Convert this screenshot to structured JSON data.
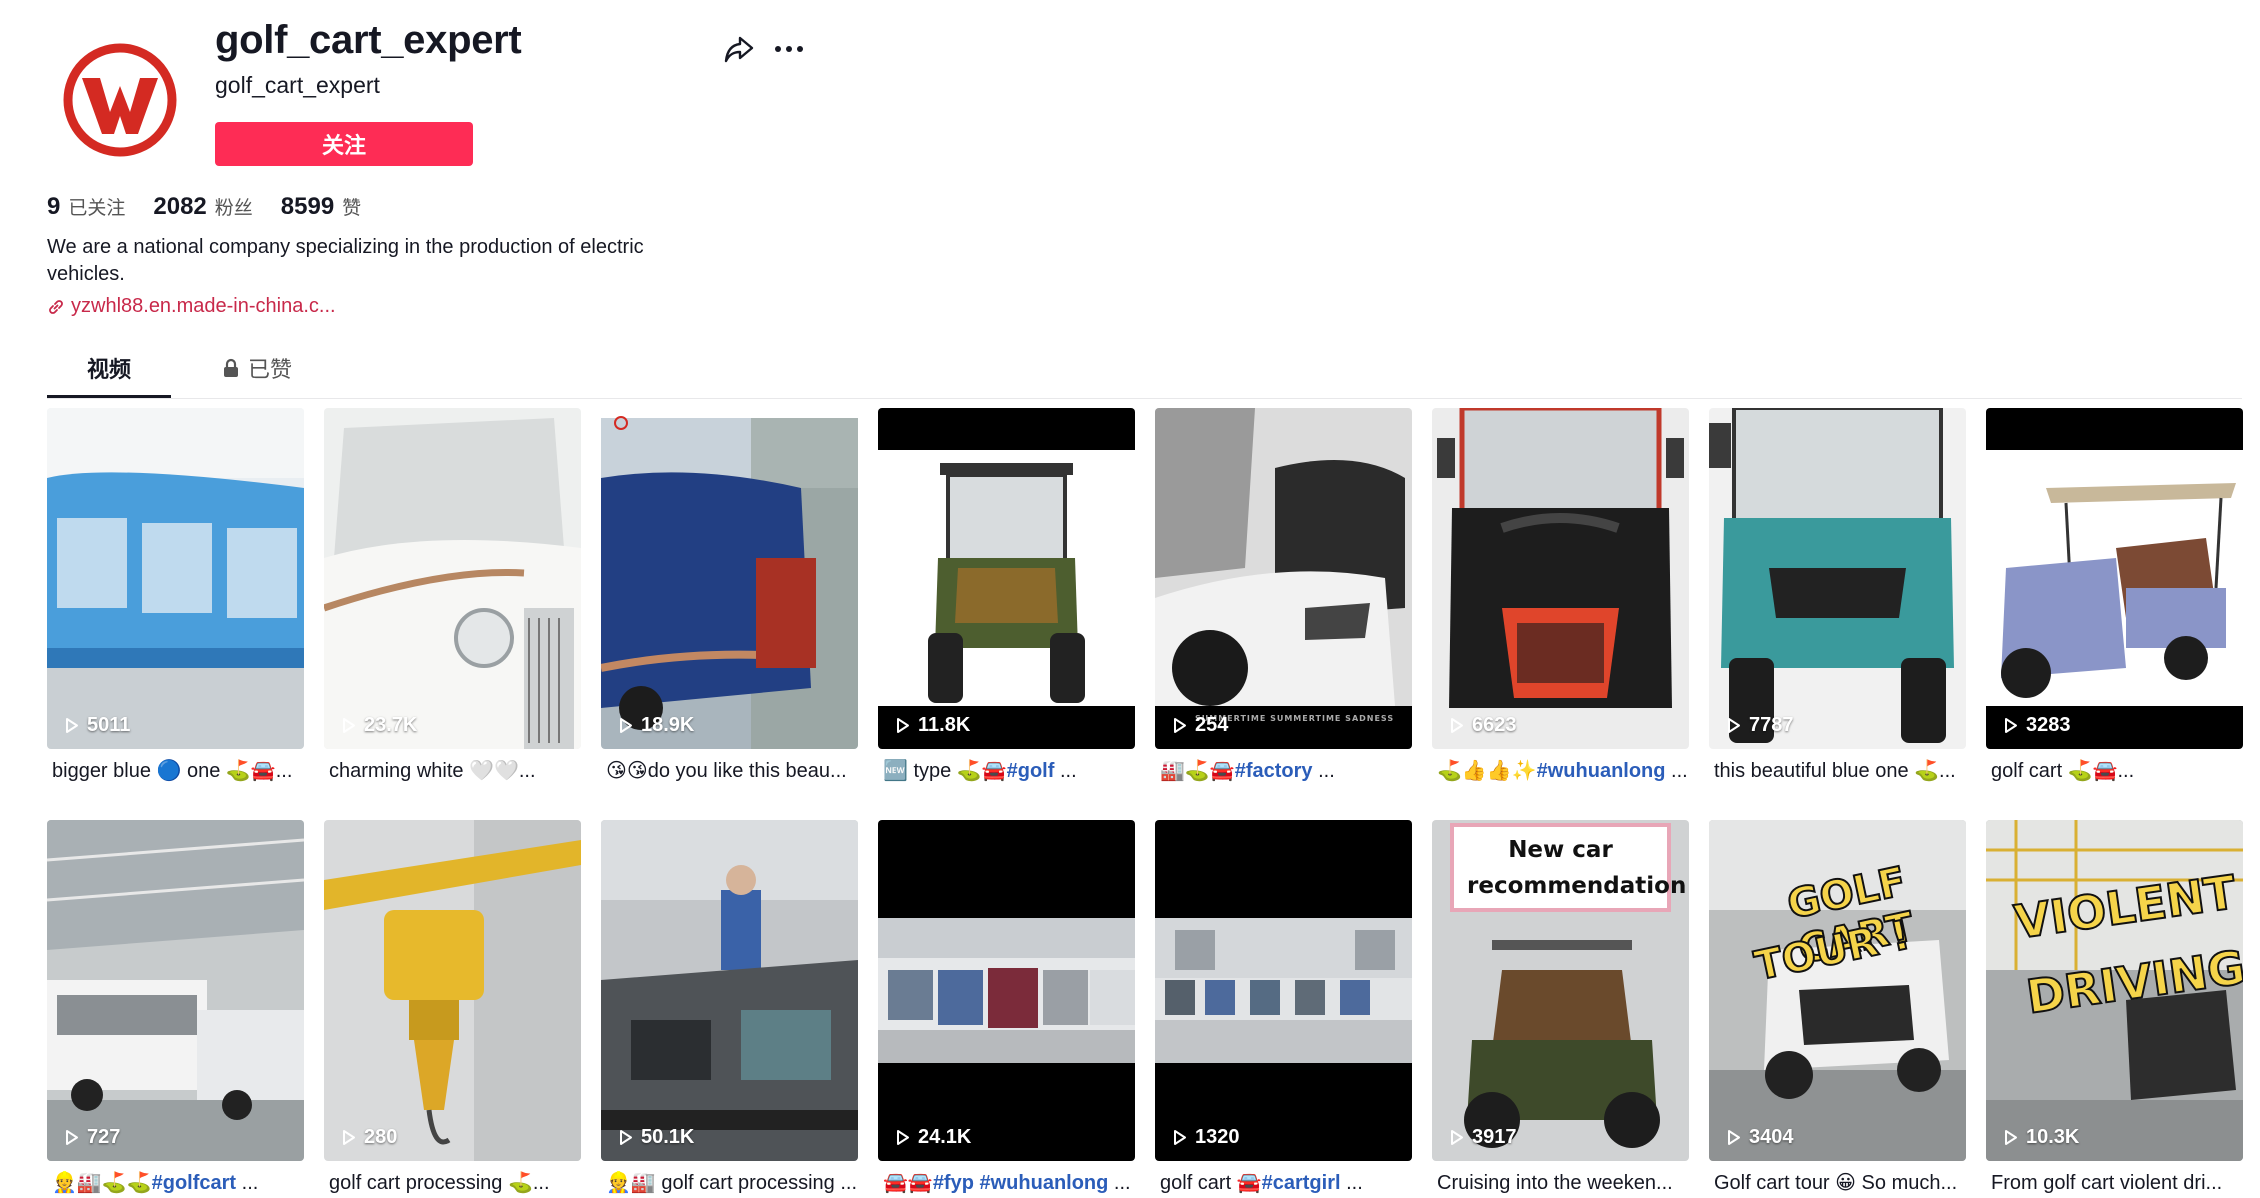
{
  "profile": {
    "title": "golf_cart_expert",
    "username": "golf_cart_expert",
    "follow_label": "关注",
    "brand_color": "#d42a22",
    "follow_color": "#fe2c55"
  },
  "stats": [
    {
      "value": "9",
      "label": "已关注"
    },
    {
      "value": "2082",
      "label": "粉丝"
    },
    {
      "value": "8599",
      "label": "赞"
    }
  ],
  "bio": "We are a national company specializing in the production of electric vehicles.",
  "link": "yzwhl88.en.made-in-china.c...",
  "tabs": {
    "videos": "视频",
    "liked": "已赞"
  },
  "videos": [
    {
      "views": "5011",
      "caption_pre": "bigger blue 🔵 one ⛳🚘...",
      "caption_tag": "",
      "caption_post": ""
    },
    {
      "views": "23.7K",
      "caption_pre": "charming white 🤍🤍...",
      "caption_tag": "",
      "caption_post": ""
    },
    {
      "views": "18.9K",
      "caption_pre": "😘😘do you like this beau...",
      "caption_tag": "",
      "caption_post": ""
    },
    {
      "views": "11.8K",
      "caption_pre": "🆕 type ⛳🚘",
      "caption_tag": "#golf",
      "caption_post": " ..."
    },
    {
      "views": "254",
      "caption_pre": "🏭⛳🚘",
      "caption_tag": "#factory",
      "caption_post": " ..."
    },
    {
      "views": "6623",
      "caption_pre": "⛳👍👍✨",
      "caption_tag": "#wuhuanlong",
      "caption_post": " ..."
    },
    {
      "views": "7787",
      "caption_pre": "this beautiful blue one ⛳...",
      "caption_tag": "",
      "caption_post": ""
    },
    {
      "views": "3283",
      "caption_pre": "golf cart ⛳🚘...",
      "caption_tag": "",
      "caption_post": ""
    },
    {
      "views": "727",
      "caption_pre": "👷🏭⛳⛳",
      "caption_tag": "#golfcart",
      "caption_post": " ..."
    },
    {
      "views": "280",
      "caption_pre": "golf cart processing ⛳...",
      "caption_tag": "",
      "caption_post": ""
    },
    {
      "views": "50.1K",
      "caption_pre": "👷🏭 golf cart processing ...",
      "caption_tag": "",
      "caption_post": ""
    },
    {
      "views": "24.1K",
      "caption_pre": "🚘🚘",
      "caption_tag": "#fyp #wuhuanlong",
      "caption_post": " ..."
    },
    {
      "views": "1320",
      "caption_pre": "golf cart 🚘",
      "caption_tag": "#cartgirl",
      "caption_post": " ..."
    },
    {
      "views": "3917",
      "caption_pre": "Cruising into the weeken...",
      "caption_tag": "",
      "caption_post": ""
    },
    {
      "views": "3404",
      "caption_pre": "Golf cart tour 😀 So much...",
      "caption_tag": "",
      "caption_post": ""
    },
    {
      "views": "10.3K",
      "caption_pre": "From golf cart violent dri...",
      "caption_tag": "",
      "caption_post": ""
    }
  ],
  "overlays": {
    "new_car": "New car recommendation",
    "golf_cart_tour_1": "GOLF CART",
    "golf_cart_tour_2": "TOUR !",
    "violent_1": "VIOLENT",
    "violent_2": "DRIVING",
    "summertime": "SUMMERTIME SUMMERTIME SADNESS"
  }
}
